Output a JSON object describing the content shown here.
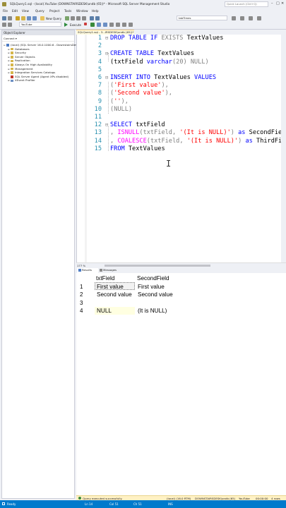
{
  "window": {
    "title": "SQLQuery1.sql - (local).YouTube (DOWNSTAIRSDESK\\ondb (65))* - Microsoft SQL Server Management Studio",
    "quick_launch": "Quick Launch (Ctrl+Q)",
    "minimize": "–",
    "maximize": "□",
    "close": "✕"
  },
  "menu": [
    "File",
    "Edit",
    "View",
    "Query",
    "Project",
    "Tools",
    "Window",
    "Help"
  ],
  "toolbar": {
    "new_query": "New Query",
    "execute": "Execute",
    "database": "YouTube",
    "search_combo": "tabTimes"
  },
  "object_explorer": {
    "title": "Object Explorer",
    "connect": "Connect ▾",
    "items": [
      {
        "label": "(local) (SQL Server 16.0.1000.6 - DownstairsDesk\\...",
        "level": 0,
        "expand": "⊟"
      },
      {
        "label": "Databases",
        "level": 1,
        "expand": "⊞"
      },
      {
        "label": "Security",
        "level": 1,
        "expand": "⊞"
      },
      {
        "label": "Server Objects",
        "level": 1,
        "expand": "⊞"
      },
      {
        "label": "Replication",
        "level": 1,
        "expand": "⊞"
      },
      {
        "label": "Always On High Availability",
        "level": 1,
        "expand": "⊞"
      },
      {
        "label": "Management",
        "level": 1,
        "expand": "⊞"
      },
      {
        "label": "Integration Services Catalogs",
        "level": 1,
        "expand": "⊞"
      },
      {
        "label": "SQL Server Agent (Agent XPs disabled)",
        "level": 1,
        "expand": ""
      },
      {
        "label": "XEvent Profiler",
        "level": 1,
        "expand": "⊞"
      }
    ]
  },
  "editor": {
    "tab_label": "SQLQuery1.sql - 3...IRSDESK\\ondb (65))*",
    "line_numbers": [
      "1",
      "2",
      "3",
      "4",
      "5",
      "6",
      "7",
      "8",
      "9",
      "10",
      "11",
      "12",
      "13",
      "14",
      "15"
    ],
    "lines": [
      [
        {
          "t": "DROP TABLE IF ",
          "c": "kw"
        },
        {
          "t": "EXISTS",
          "c": "gray"
        },
        {
          "t": " TextValues",
          "c": ""
        }
      ],
      [],
      [
        {
          "t": "CREATE TABLE ",
          "c": "kw"
        },
        {
          "t": "TextValues",
          "c": ""
        }
      ],
      [
        {
          "t": "(txtField ",
          "c": ""
        },
        {
          "t": "varchar",
          "c": "kw"
        },
        {
          "t": "(20) ",
          "c": "gray"
        },
        {
          "t": "NULL",
          "c": "gray"
        },
        {
          "t": ")",
          "c": "gray"
        }
      ],
      [],
      [
        {
          "t": "INSERT INTO ",
          "c": "kw"
        },
        {
          "t": "TextValues ",
          "c": ""
        },
        {
          "t": "VALUES",
          "c": "kw"
        }
      ],
      [
        {
          "t": "(",
          "c": "gray"
        },
        {
          "t": "'First value'",
          "c": "str"
        },
        {
          "t": "),",
          "c": "gray"
        }
      ],
      [
        {
          "t": "(",
          "c": "gray"
        },
        {
          "t": "'Second value'",
          "c": "str"
        },
        {
          "t": "),",
          "c": "gray"
        }
      ],
      [
        {
          "t": "(",
          "c": "gray"
        },
        {
          "t": "''",
          "c": "str"
        },
        {
          "t": "),",
          "c": "gray"
        }
      ],
      [
        {
          "t": "(",
          "c": "gray"
        },
        {
          "t": "NULL",
          "c": "gray"
        },
        {
          "t": ")",
          "c": "gray"
        }
      ],
      [],
      [
        {
          "t": "SELECT ",
          "c": "kw"
        },
        {
          "t": "txtField",
          "c": ""
        }
      ],
      [
        {
          "t": ", ",
          "c": "gray"
        },
        {
          "t": "ISNULL",
          "c": "fn"
        },
        {
          "t": "(txtField, ",
          "c": "gray"
        },
        {
          "t": "'(It is NULL)'",
          "c": "str"
        },
        {
          "t": ") ",
          "c": "gray"
        },
        {
          "t": "as ",
          "c": "kw"
        },
        {
          "t": "SecondField",
          "c": ""
        }
      ],
      [
        {
          "t": ", ",
          "c": "gray"
        },
        {
          "t": "COALESCE",
          "c": "fn"
        },
        {
          "t": "(txtField, ",
          "c": "gray"
        },
        {
          "t": "'(It is NULL)'",
          "c": "str"
        },
        {
          "t": ") ",
          "c": "gray"
        },
        {
          "t": "as ",
          "c": "kw"
        },
        {
          "t": "ThirdField",
          "c": ""
        }
      ],
      [
        {
          "t": "FROM ",
          "c": "kw"
        },
        {
          "t": "TextValues",
          "c": ""
        }
      ]
    ],
    "zoom": "177 %"
  },
  "results": {
    "tab_results": "Results",
    "tab_messages": "Messages",
    "columns": [
      "txtField",
      "SecondField"
    ],
    "rows": [
      {
        "n": "1",
        "cells": [
          "First value",
          "First value"
        ]
      },
      {
        "n": "2",
        "cells": [
          "Second value",
          "Second value"
        ]
      },
      {
        "n": "3",
        "cells": [
          "",
          ""
        ]
      },
      {
        "n": "4",
        "cells": [
          "NULL",
          "(It is NULL)"
        ]
      }
    ]
  },
  "status": {
    "message": "Query executed successfully.",
    "server": "(local) (16.0 RTM)",
    "user": "DOWNSTAIRSDESK\\ondb (65)",
    "db": "YouTube",
    "time": "00:00:00",
    "rows": "4 rows"
  },
  "ready_bar": {
    "state": "Ready",
    "ln": "Ln 14",
    "col": "Col 51",
    "ch": "Ch 51",
    "mode": "INS"
  },
  "colors": {
    "keyword": "#0000ff",
    "function": "#ff00ff",
    "string": "#ff0000",
    "line_number": "#2b91af",
    "status_accent": "#007acc"
  }
}
